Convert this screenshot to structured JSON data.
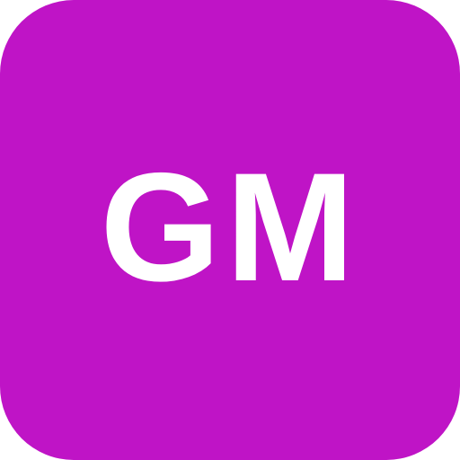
{
  "avatar": {
    "initials": "GM",
    "background_color": "#bf14c6",
    "text_color": "#ffffff"
  }
}
